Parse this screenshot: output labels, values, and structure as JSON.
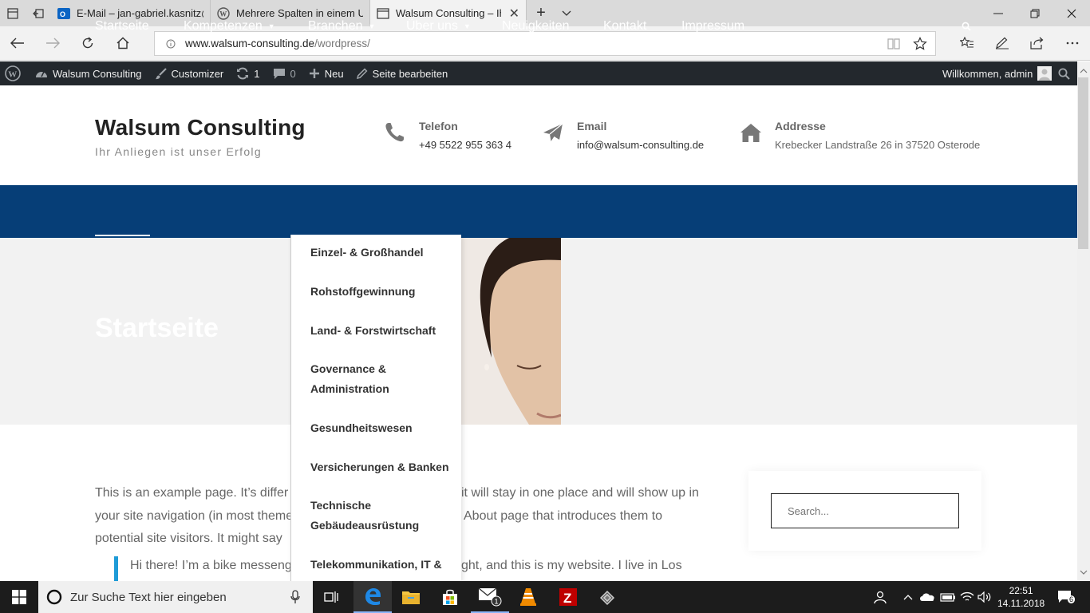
{
  "browser": {
    "tabs": [
      {
        "label": "E-Mail – jan-gabriel.kasnitz@",
        "icon": "outlook-icon",
        "active": false
      },
      {
        "label": "Mehrere Spalten in einem U",
        "icon": "wordpress-icon",
        "active": false
      },
      {
        "label": "Walsum Consulting – Ih",
        "icon": "page-icon",
        "active": true
      }
    ],
    "url_host": "www.walsum-consulting.de",
    "url_path": "/wordpress/"
  },
  "adminbar": {
    "site_name": "Walsum Consulting",
    "customizer": "Customizer",
    "updates_count": "1",
    "comments_count": "0",
    "new_label": "Neu",
    "edit_label": "Seite bearbeiten",
    "welcome": "Willkommen, admin"
  },
  "header": {
    "title": "Walsum Consulting",
    "tagline": "Ihr Anliegen ist unser Erfolg",
    "phone_label": "Telefon",
    "phone_value": "+49 5522 955 363 4",
    "email_label": "Email",
    "email_value": "info@walsum-consulting.de",
    "address_label": "Addresse",
    "address_value": "Krebecker Landstraße 26 in 37520 Osterode"
  },
  "nav": {
    "items": [
      {
        "label": "Startseite",
        "active": true,
        "has_submenu": false
      },
      {
        "label": "Kompetenzen",
        "active": false,
        "has_submenu": true
      },
      {
        "label": "Branchen",
        "active": false,
        "has_submenu": true
      },
      {
        "label": "Über uns",
        "active": false,
        "has_submenu": true
      },
      {
        "label": "Neuigkeiten",
        "active": false,
        "has_submenu": false
      },
      {
        "label": "Kontakt",
        "active": false,
        "has_submenu": false
      },
      {
        "label": "Impressum",
        "active": false,
        "has_submenu": false
      }
    ]
  },
  "dropdown": {
    "items": [
      "Einzel- & Großhandel",
      "Rohstoffgewinnung",
      "Land- & Forstwirtschaft",
      "Governance & Administration",
      "Gesundheitswesen",
      "Versicherungen & Banken",
      "Technische Gebäudeausrüstung",
      "Telekommunikation, IT &"
    ]
  },
  "hero": {
    "title": "Startseite"
  },
  "content": {
    "line1a": "This is an example page. It’s differ",
    "line1b": "it will stay in one place and will show up in",
    "line2a": "your site navigation (in most theme",
    "line2b": "About page that introduces them to",
    "line3a": "potential site visitors. It might say",
    "quote_a": "Hi there! I’m a bike messeng",
    "quote_b": "ght, and this is my website. I live in Los"
  },
  "sidebar": {
    "search_placeholder": "Search..."
  },
  "taskbar": {
    "search_text": "Zur Suche Text hier eingeben",
    "time": "22:51",
    "date": "14.11.2018",
    "notifications": "6"
  },
  "colors": {
    "nav_bg": "#063e77",
    "adminbar_bg": "#23282d",
    "quote_accent": "#1e9bd7"
  }
}
